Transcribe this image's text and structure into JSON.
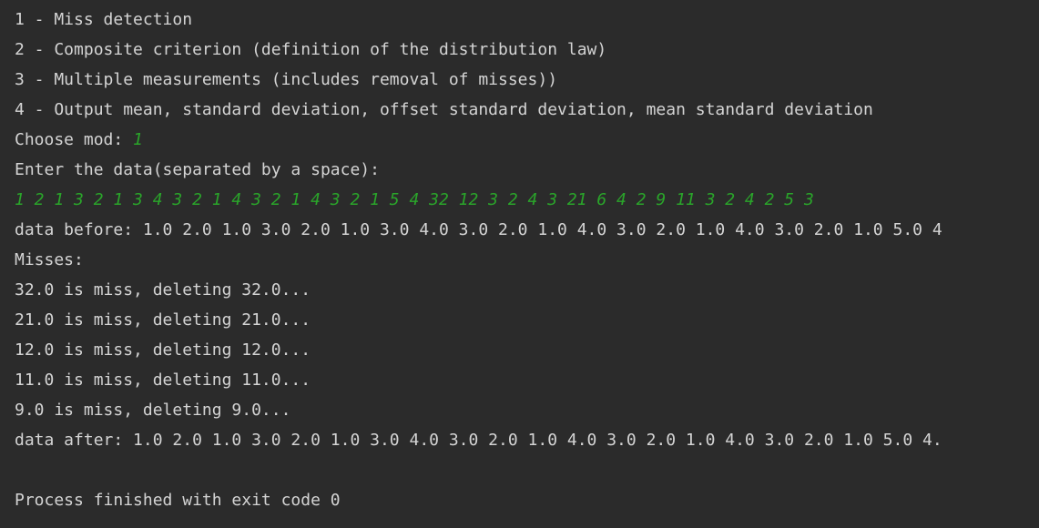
{
  "console": {
    "lines": [
      {
        "text": "1 - Miss detection"
      },
      {
        "text": "2 - Composite criterion (definition of the distribution law)"
      },
      {
        "text": "3 - Multiple measurements (includes removal of misses))"
      },
      {
        "text": "4 - Output mean, standard deviation, offset standard deviation, mean standard deviation"
      },
      {
        "prompt": "Choose mod: ",
        "input": "1"
      },
      {
        "text": "Enter the data(separated by a space):"
      },
      {
        "input": "1 2 1 3 2 1 3 4 3 2 1 4 3 2 1 4 3 2 1 5 4 32 12 3 2 4 3 21 6 4 2 9 11 3 2 4 2 5 3"
      },
      {
        "text": "data before: 1.0 2.0 1.0 3.0 2.0 1.0 3.0 4.0 3.0 2.0 1.0 4.0 3.0 2.0 1.0 4.0 3.0 2.0 1.0 5.0 4"
      },
      {
        "text": "Misses:"
      },
      {
        "text": "32.0 is miss, deleting 32.0..."
      },
      {
        "text": "21.0 is miss, deleting 21.0..."
      },
      {
        "text": "12.0 is miss, deleting 12.0..."
      },
      {
        "text": "11.0 is miss, deleting 11.0..."
      },
      {
        "text": "9.0 is miss, deleting 9.0..."
      },
      {
        "text": "data after: 1.0 2.0 1.0 3.0 2.0 1.0 3.0 4.0 3.0 2.0 1.0 4.0 3.0 2.0 1.0 4.0 3.0 2.0 1.0 5.0 4."
      },
      {
        "text": ""
      },
      {
        "text": "Process finished with exit code 0"
      }
    ]
  },
  "colors": {
    "background": "#2b2b2b",
    "text": "#d4d4d4",
    "user_input": "#2aa52a"
  }
}
